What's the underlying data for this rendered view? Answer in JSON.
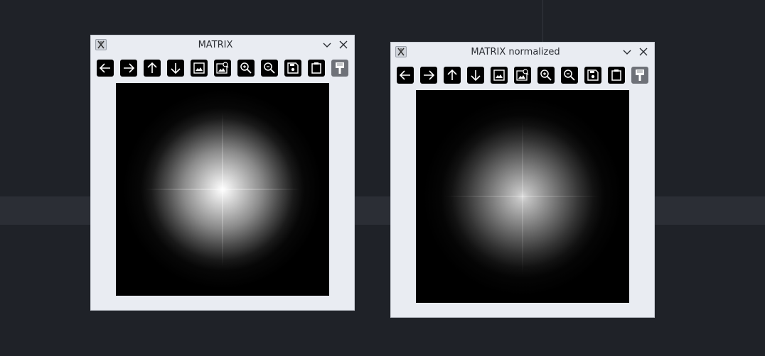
{
  "desktop": {
    "background": "#1f2228"
  },
  "windows": [
    {
      "title": "MATRIX",
      "app_icon": "x11-app-icon",
      "controls": [
        "chevron-down-icon",
        "close-icon"
      ],
      "toolbar": [
        "arrow-left-icon",
        "arrow-right-icon",
        "arrow-up-icon",
        "arrow-down-icon",
        "image-icon",
        "image-search-icon",
        "zoom-in-icon",
        "zoom-out-icon",
        "save-icon",
        "clipboard-icon",
        "paint-brush-icon"
      ],
      "image": "gaussian-blob-bright"
    },
    {
      "title": "MATRIX normalized",
      "app_icon": "x11-app-icon",
      "controls": [
        "chevron-down-icon",
        "close-icon"
      ],
      "toolbar": [
        "arrow-left-icon",
        "arrow-right-icon",
        "arrow-up-icon",
        "arrow-down-icon",
        "image-icon",
        "image-search-icon",
        "zoom-in-icon",
        "zoom-out-icon",
        "save-icon",
        "clipboard-icon",
        "paint-brush-icon"
      ],
      "image": "gaussian-blob-dim"
    }
  ]
}
